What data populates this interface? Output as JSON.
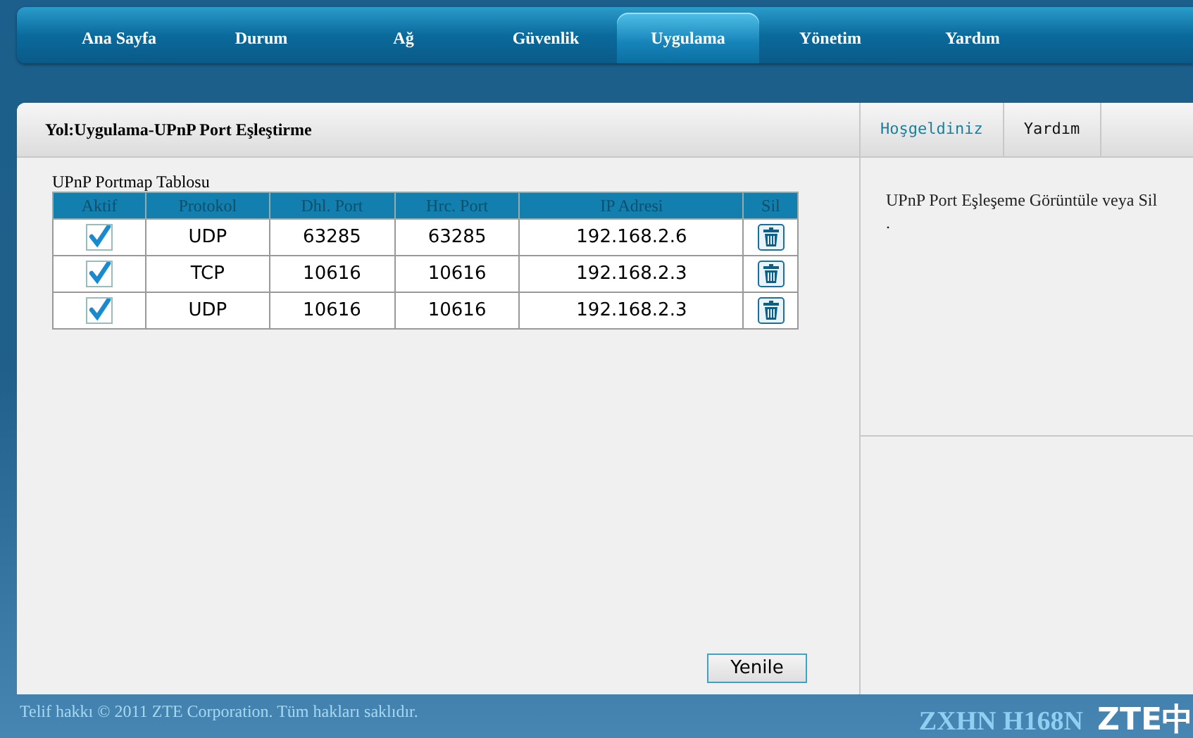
{
  "nav": {
    "tabs": [
      {
        "label": "Ana Sayfa",
        "selected": false
      },
      {
        "label": "Durum",
        "selected": false
      },
      {
        "label": "Ağ",
        "selected": false
      },
      {
        "label": "Güvenlik",
        "selected": false
      },
      {
        "label": "Uygulama",
        "selected": true
      },
      {
        "label": "Yönetim",
        "selected": false
      },
      {
        "label": "Yardım",
        "selected": false
      }
    ]
  },
  "breadcrumb": "Yol:Uygulama-UPnP Port Eşleştirme",
  "table": {
    "caption": "UPnP Portmap Tablosu",
    "columns": [
      "Aktif",
      "Protokol",
      "Dhl. Port",
      "Hrc. Port",
      "IP Adresi",
      "Sil"
    ],
    "rows": [
      {
        "checked": true,
        "cells": [
          "",
          "UDP",
          "63285",
          "63285",
          "192.168.2.6"
        ]
      },
      {
        "checked": true,
        "cells": [
          "",
          "TCP",
          "10616",
          "10616",
          "192.168.2.3"
        ]
      },
      {
        "checked": true,
        "cells": [
          "",
          "UDP",
          "10616",
          "10616",
          "192.168.2.3"
        ]
      }
    ]
  },
  "refresh_button": "Yenile",
  "side_tabs": [
    {
      "label": "Hoşgeldiniz",
      "selected": true
    },
    {
      "label": "Yardım",
      "selected": false
    }
  ],
  "help_text": "UPnP Port Eşleşeme Görüntüle veya Sil",
  "help_text_2": ".",
  "footer": {
    "copyright": "Telif hakkı © 2011 ZTE Corporation. Tüm hakları saklıdır.",
    "model": "ZXHN H168N",
    "logo": "ZTE中"
  }
}
